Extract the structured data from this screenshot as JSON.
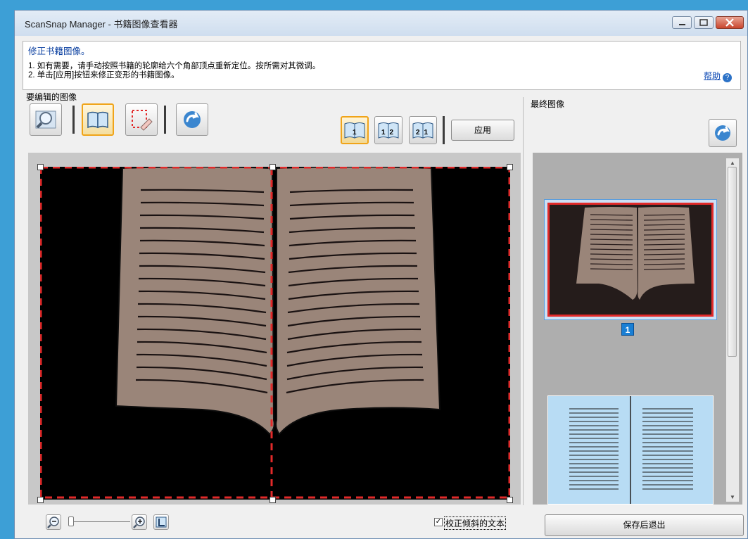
{
  "window": {
    "title": "ScanSnap Manager - 书籍图像查看器"
  },
  "info": {
    "heading": "修正书籍图像。",
    "line1": "1. 如有需要，请手动按照书籍的轮廓给六个角部顶点重新定位。按所需对其微调。",
    "line2": "2. 单击[应用]按钮来修正变形的书籍图像。",
    "help_label": "帮助"
  },
  "left_panel": {
    "title": "要编辑的图像",
    "apply_label": "应用",
    "view_buttons": [
      "1",
      "12",
      "21"
    ]
  },
  "right_panel": {
    "title": "最终图像",
    "page_number": "1"
  },
  "bottom": {
    "checkbox_label": "校正倾斜的文本",
    "checkbox_checked": true,
    "save_label": "保存后退出"
  },
  "colors": {
    "accent_selected": "#f0a419",
    "crop_line": "#e12a2a",
    "page_fill": "#9a8579",
    "window_bg": "#f0f0f0"
  }
}
